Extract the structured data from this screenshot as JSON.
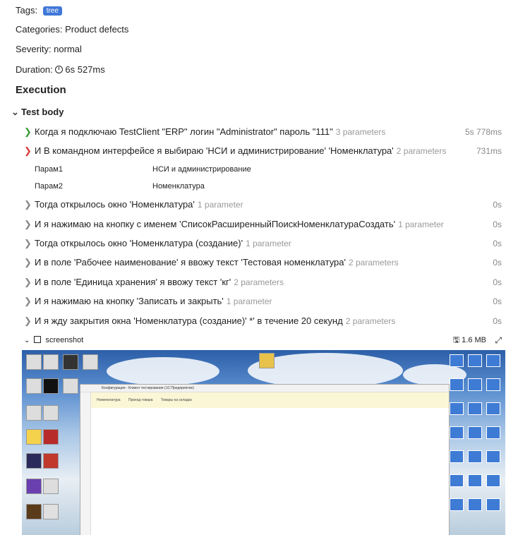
{
  "meta": {
    "tags_label": "Tags:",
    "tag": "tree",
    "categories": "Categories: Product defects",
    "severity": "Severity: normal",
    "duration_label": "Duration:",
    "duration": "6s 527ms"
  },
  "execution_title": "Execution",
  "test_body": "Test body",
  "steps": [
    {
      "text": "Когда я подключаю TestClient \"ERP\" логин \"Administrator\" пароль \"111\"",
      "params": "3 parameters",
      "dur": "5s 778ms"
    },
    {
      "text": "И В командном интерфейсе я выбираю 'НСИ и администрирование' 'Номенклатура'",
      "params": "2 parameters",
      "dur": "731ms"
    },
    {
      "text": "Тогда открылось окно 'Номенклатура'",
      "params": "1 parameter",
      "dur": "0s"
    },
    {
      "text": "И я нажимаю на кнопку с именем 'СписокРасширенныйПоискНоменклатураСоздать'",
      "params": "1 parameter",
      "dur": "0s"
    },
    {
      "text": "Тогда открылось окно 'Номенклатура (создание)'",
      "params": "1 parameter",
      "dur": "0s"
    },
    {
      "text": "И в поле 'Рабочее наименование' я ввожу текст 'Тестовая номенклатура'",
      "params": "2 parameters",
      "dur": "0s"
    },
    {
      "text": "И в поле 'Единица хранения' я ввожу текст 'кг'",
      "params": "2 parameters",
      "dur": "0s"
    },
    {
      "text": "И я нажимаю на кнопку 'Записать и закрыть'",
      "params": "1 parameter",
      "dur": "0s"
    },
    {
      "text": "И я жду закрытия окна 'Номенклатура (создание)' *' в течение 20 секунд",
      "params": "2 parameters",
      "dur": "0s"
    }
  ],
  "step_params": [
    {
      "name": "Парам1",
      "value": "НСИ и администрирование"
    },
    {
      "name": "Парам2",
      "value": "Номенклатура"
    }
  ],
  "attachment": {
    "name": "screenshot",
    "size": "1.6 MB"
  },
  "screenshot_window": {
    "title": "Конфигурация - Клиент тестирования (1С:Предприятие)",
    "tabs": [
      "Номенклатура",
      "Приход товара",
      "Товары на складах"
    ]
  },
  "colors": {
    "tag_bg": "#3f78d8",
    "passed": "#3a9b35",
    "failed": "#d93a3a"
  }
}
